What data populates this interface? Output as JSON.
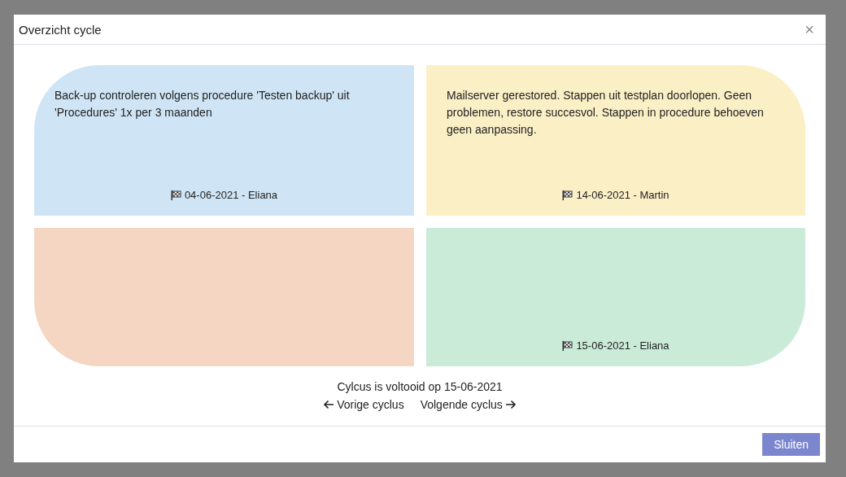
{
  "dialog": {
    "title": "Overzicht cycle",
    "close": "×"
  },
  "quadrants": [
    {
      "color": "#cfe5f5",
      "note": "Back-up controleren volgens procedure 'Testen backup' uit 'Procedures' 1x per 3 maanden",
      "footer": "04-06-2021 - Eliana"
    },
    {
      "color": "#fbefc6",
      "note": "Mailserver gerestored. Stappen uit testplan doorlopen. Geen problemen, restore succesvol. Stappen in procedure behoeven geen aanpassing.",
      "footer": "14-06-2021 - Martin"
    },
    {
      "color": "#f4d6c3"
    },
    {
      "color": "#cbebd9",
      "footer": "15-06-2021 - Eliana"
    }
  ],
  "status": "Cylcus is voltooid op 15-06-2021",
  "nav": {
    "previous": "Vorige cyclus",
    "next": "Volgende cyclus"
  },
  "buttons": [
    "Sluiten"
  ]
}
